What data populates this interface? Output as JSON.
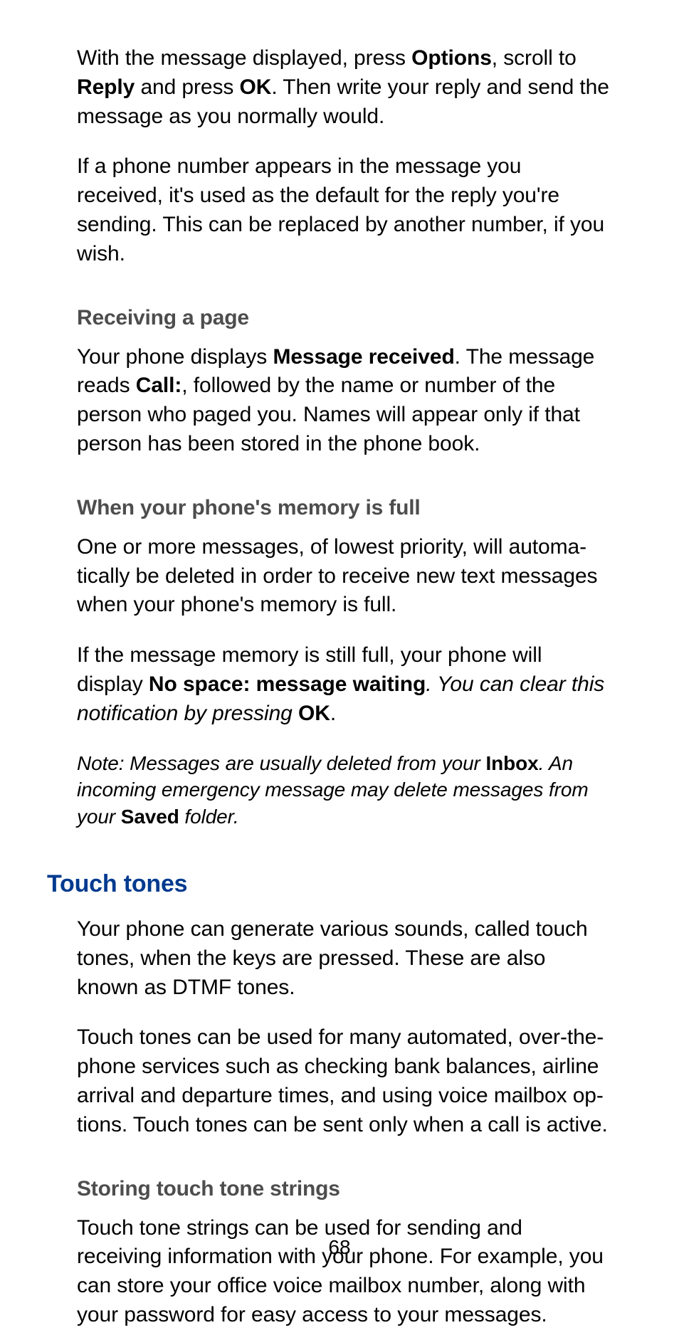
{
  "intro": {
    "p1_a": "With the message displayed, press ",
    "p1_b_options": "Options",
    "p1_c": ", scroll to ",
    "p1_b_reply": "Reply",
    "p1_d": " and press ",
    "p1_b_ok": "OK",
    "p1_e": ". Then write your reply and send the message as you normally would.",
    "p2": "If a phone number appears in the message you received, it's used as the default for the reply you're sending. This can be replaced by another number, if you wish."
  },
  "receiving": {
    "heading": "Receiving a page",
    "p1_a": "Your phone displays ",
    "p1_b_msg": "Message received",
    "p1_c": ". The message reads ",
    "p1_b_call": "Call:",
    "p1_d": ", followed by the name or number of the person who paged you. Names will appear only if that person has been stored in the phone book."
  },
  "memory": {
    "heading": "When your phone's memory is full",
    "p1": "One or more messages, of lowest priority, will automa­tically be deleted in order to receive new text messages when your phone's memory is full.",
    "p2_a": "If the message memory is still full, your phone will display ",
    "p2_b_nospace": "No space: message waiting",
    "p2_c": ". You can clear this notification by pressing ",
    "p2_b_ok": "OK",
    "p2_d": ".",
    "note_a": "Note: Messages are usually deleted from your ",
    "note_b_inbox": "Inbox",
    "note_c": ". An incoming emergency message may delete messages from your ",
    "note_b_saved": "Saved",
    "note_d": " folder."
  },
  "touchtones": {
    "heading": "Touch tones",
    "p1": "Your phone can generate various sounds, called touch tones, when the keys are pressed. These are also known as DTMF tones.",
    "p2": "Touch tones can be used for many automated, over-the-phone services such as checking bank balances, airline arrival and departure times, and using voice mailbox op­tions. Touch tones can be sent only when a call is active."
  },
  "storing": {
    "heading": "Storing touch tone strings",
    "p1": "Touch tone strings can be used for sending and receiving information with your phone. For example, you can store your office voice mailbox number, along with your password for easy access to your messages."
  },
  "page_number": "68"
}
